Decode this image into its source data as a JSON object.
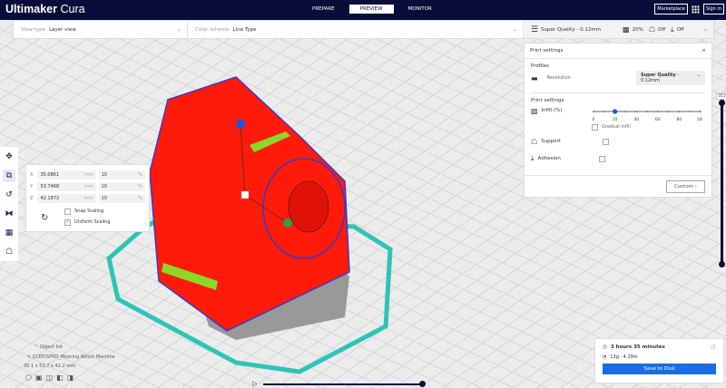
{
  "header": {
    "logo_bold": "Ultimaker",
    "logo_light": "Cura",
    "stages": [
      "PREPARE",
      "PREVIEW",
      "MONITOR"
    ],
    "active_stage": "PREVIEW",
    "marketplace": "Marketplace",
    "signin": "Sign in"
  },
  "toolbar": {
    "view_type_label": "View type",
    "view_type_value": "Layer view",
    "color_scheme_label": "Color scheme",
    "color_scheme_value": "Line Type",
    "profile": "Super Quality - 0.12mm",
    "infill": "20%",
    "support": "Off",
    "adhesion": "Off"
  },
  "print_settings": {
    "title": "Print settings",
    "close": "×",
    "profiles_label": "Profiles",
    "resolution_label": "Resolution",
    "resolution_bold": "Super Quality",
    "resolution_rest": " - 0.12mm",
    "section": "Print settings",
    "infill_label": "Infill (%)",
    "infill_value": 20,
    "infill_ticks": [
      "0",
      "20",
      "40",
      "60",
      "80",
      "100"
    ],
    "gradual_infill": "Gradual infill",
    "support": "Support",
    "adhesion": "Adhesion",
    "custom": "Custom"
  },
  "scale": {
    "rows": [
      {
        "axis": "X",
        "mm": "35.0861",
        "unit": "mm",
        "pct": "10",
        "pct_unit": "%"
      },
      {
        "axis": "Y",
        "mm": "53.7468",
        "unit": "mm",
        "pct": "10",
        "pct_unit": "%"
      },
      {
        "axis": "Z",
        "mm": "42.1872",
        "unit": "mm",
        "pct": "10",
        "pct_unit": "%"
      }
    ],
    "snap": "Snap Scaling",
    "uniform": "Uniform Scaling",
    "snap_checked": false,
    "uniform_checked": true
  },
  "layer": {
    "label": "351"
  },
  "object": {
    "list_label": "Object list",
    "name": "CCRT(SPRO_Mooring Winch Machine",
    "dims": "35.1 x 53.7 x 42.2 mm"
  },
  "estimate": {
    "time": "3 hours 35 minutes",
    "material": "13g · 4.29m",
    "save": "Save to Disk"
  },
  "colors": {
    "header": "#0a0d3a",
    "accent": "#1b6be5",
    "model": "#ff1a0a",
    "skirt": "#2ec4b6"
  }
}
